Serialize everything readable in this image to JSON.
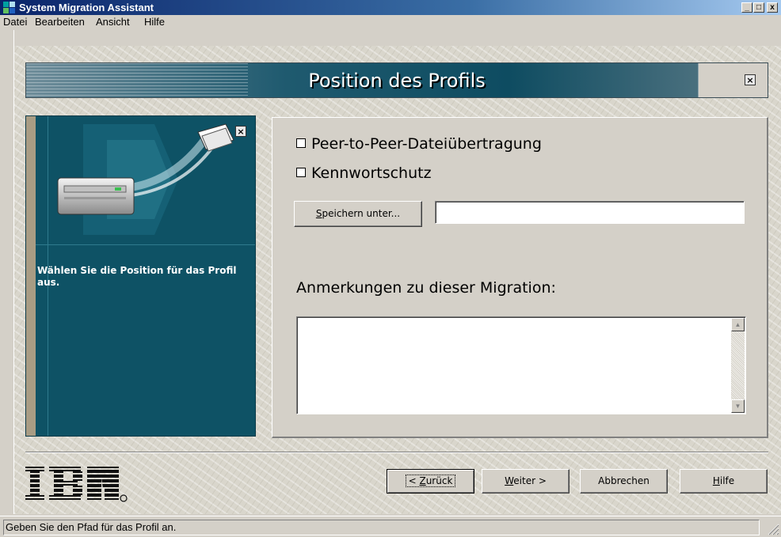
{
  "window": {
    "title": "System Migration Assistant",
    "controls": {
      "minimize": "_",
      "maximize": "□",
      "close": "x"
    }
  },
  "menu": [
    "Datei",
    "Bearbeiten",
    "Ansicht",
    "Hilfe"
  ],
  "banner": {
    "title": "Position des Profils",
    "close_glyph": "×"
  },
  "side_panel": {
    "text": "Wählen Sie die Position für das Profil aus.",
    "close_glyph": "×"
  },
  "form": {
    "checkbox_peer": "Peer-to-Peer-Dateiübertragung",
    "checkbox_password": "Kennwortschutz",
    "save_as_label_u": "S",
    "save_as_label_rest": "peichern unter...",
    "save_path_value": "",
    "notes_label": "Anmerkungen zu dieser Migration:",
    "notes_value": ""
  },
  "footer": {
    "back_prefix": "< ",
    "back_u": "Z",
    "back_rest": "urück",
    "next_u": "W",
    "next_rest": "eiter >",
    "cancel": "Abbrechen",
    "help_u": "H",
    "help_rest": "ilfe",
    "logo_text": "IBM"
  },
  "status": {
    "text": "Geben Sie den Pfad für das Profil an."
  },
  "colors": {
    "banner": "#0e4c61",
    "side_panel": "#0e5265",
    "face": "#d4d0c8"
  }
}
